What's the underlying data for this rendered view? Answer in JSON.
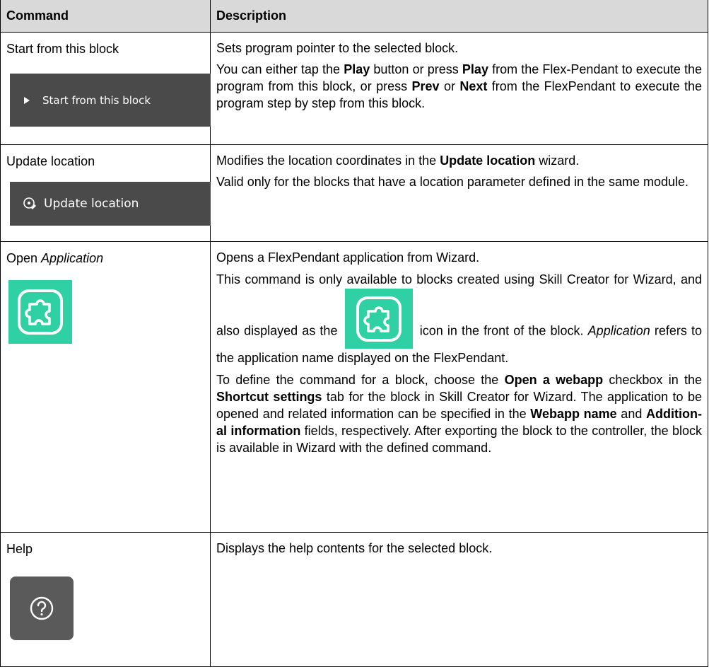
{
  "headers": {
    "command": "Command",
    "description": "Description"
  },
  "rows": [
    {
      "command": "Start from this block",
      "button_label": "Start from this block",
      "desc": [
        {
          "t1": "Sets program pointer to the selected block."
        },
        {
          "t1": "You can either tap the ",
          "b1": "Play",
          "t2": " button or press ",
          "b2": "Play",
          "t3": " from the Flex-Pendant to execute the program from this block, or press ",
          "b3": "Prev",
          "t4": " or ",
          "b4": "Next",
          "t5": " from the FlexPendant to execute the program step by step from this block."
        }
      ],
      "icon": "play-icon"
    },
    {
      "command": "Update location",
      "button_label": "Update location",
      "desc": [
        {
          "t1": "Modifies the location coordinates in the ",
          "b1": "Update location",
          "t2": " wizard."
        },
        {
          "t1": "Valid only for the blocks that have a location parameter defined in the same module."
        }
      ],
      "icon": "location-edit-icon"
    },
    {
      "command_prefix": "Open ",
      "command_italic": "Application",
      "desc": [
        {
          "t1": "Opens a FlexPendant application from Wizard."
        },
        {
          "t1": "This command is only available to blocks created using Skill Creator for Wizard, and also displayed as the",
          "t2": "icon in the front of the block. ",
          "i1": "Application",
          "t3": " refers to the application name displayed on the FlexPendant."
        },
        {
          "t1": "To define the command for a block, choose the ",
          "b1": "Open a webapp",
          "t2": " checkbox in the ",
          "b2": "Shortcut settings",
          "t3": " tab for the block in Skill Creator for Wizard. The application to be opened and related information can be specified in the ",
          "b3": "Webapp name",
          "t4": " and ",
          "b4": "Addition-al information",
          "t5": " fields, respectively. After exporting the block to the controller, the block is available in Wizard with the defined command."
        }
      ],
      "icon": "puzzle-icon",
      "icon_color": "#2fd1a4"
    },
    {
      "command": "Help",
      "desc": [
        {
          "t1": "Displays the help contents for the selected block."
        }
      ],
      "icon": "help-icon"
    }
  ],
  "colors": {
    "header_bg": "#d9d9d9",
    "button_bg": "#4a4a4a",
    "accent": "#2fd1a4"
  }
}
